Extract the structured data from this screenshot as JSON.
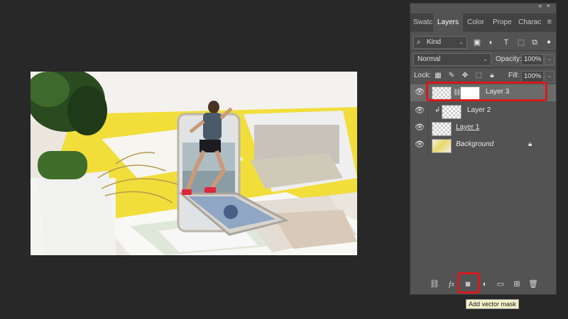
{
  "panel": {
    "collapse_glyph": "«  ×",
    "tabs": [
      "Swatc",
      "Layers",
      "Color",
      "Prope",
      "Charac"
    ],
    "active_tab": "Layers",
    "menu_icon": "panel-menu-icon"
  },
  "filter": {
    "kind_label": "Kind"
  },
  "blend": {
    "mode": "Normal",
    "opacity_label": "Opacity:",
    "opacity_value": "100%"
  },
  "lock": {
    "label": "Lock:",
    "fill_label": "Fill:",
    "fill_value": "100%"
  },
  "layers": [
    {
      "name": "Layer 3",
      "selected": true
    },
    {
      "name": "Layer 2",
      "selected": false
    },
    {
      "name": "Layer 1",
      "selected": false
    },
    {
      "name": "Background",
      "selected": false
    }
  ],
  "tooltip": "Add vector mask",
  "colors": {
    "highlight": "#d8191c",
    "panel_bg": "#535353",
    "canvas_bg": "#282828"
  }
}
